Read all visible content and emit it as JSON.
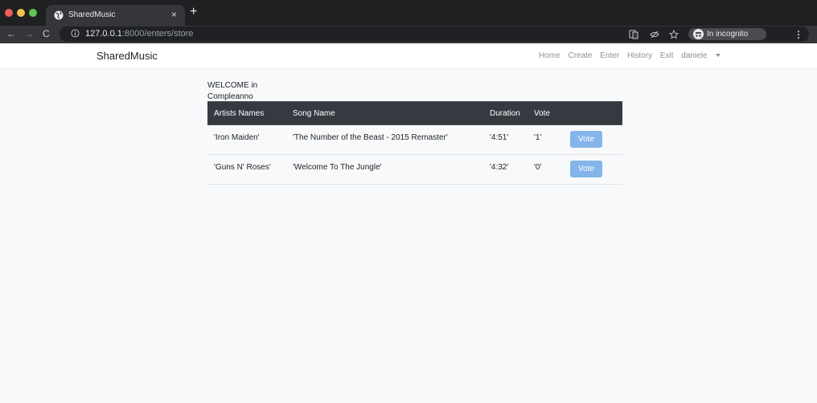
{
  "browser": {
    "tab_title": "SharedMusic",
    "tab_close": "×",
    "new_tab": "+",
    "url_host": "127.0.0.1",
    "url_path": ":8000/enters/store",
    "incognito_label": "In incognito",
    "nav_back": "←",
    "nav_forward": "→",
    "nav_reload": "C",
    "menu": "⋮",
    "icons": [
      "translate-icon",
      "eye-off-icon",
      "star-icon",
      "incognito-icon"
    ]
  },
  "navbar": {
    "brand": "SharedMusic",
    "links": [
      "Home",
      "Create",
      "Enter",
      "History",
      "Exit"
    ],
    "user": "daniele"
  },
  "page": {
    "welcome": "WELCOME in Compleanno"
  },
  "table": {
    "headers": [
      "Artists Names",
      "Song Name",
      "Duration",
      "Vote"
    ],
    "rows": [
      {
        "artist": "'Iron Maiden'",
        "song": "'The Number of the Beast - 2015 Remaster'",
        "duration": "'4:51'",
        "vote": "'1'",
        "button": "Vote"
      },
      {
        "artist": "'Guns N' Roses'",
        "song": "'Welcome To The Jungle'",
        "duration": "'4:32'",
        "vote": "'0'",
        "button": "Vote"
      }
    ]
  },
  "colors": {
    "table_header": "#343a40",
    "vote_button": "#84b5ea",
    "page_background": "#f8f9fa"
  }
}
